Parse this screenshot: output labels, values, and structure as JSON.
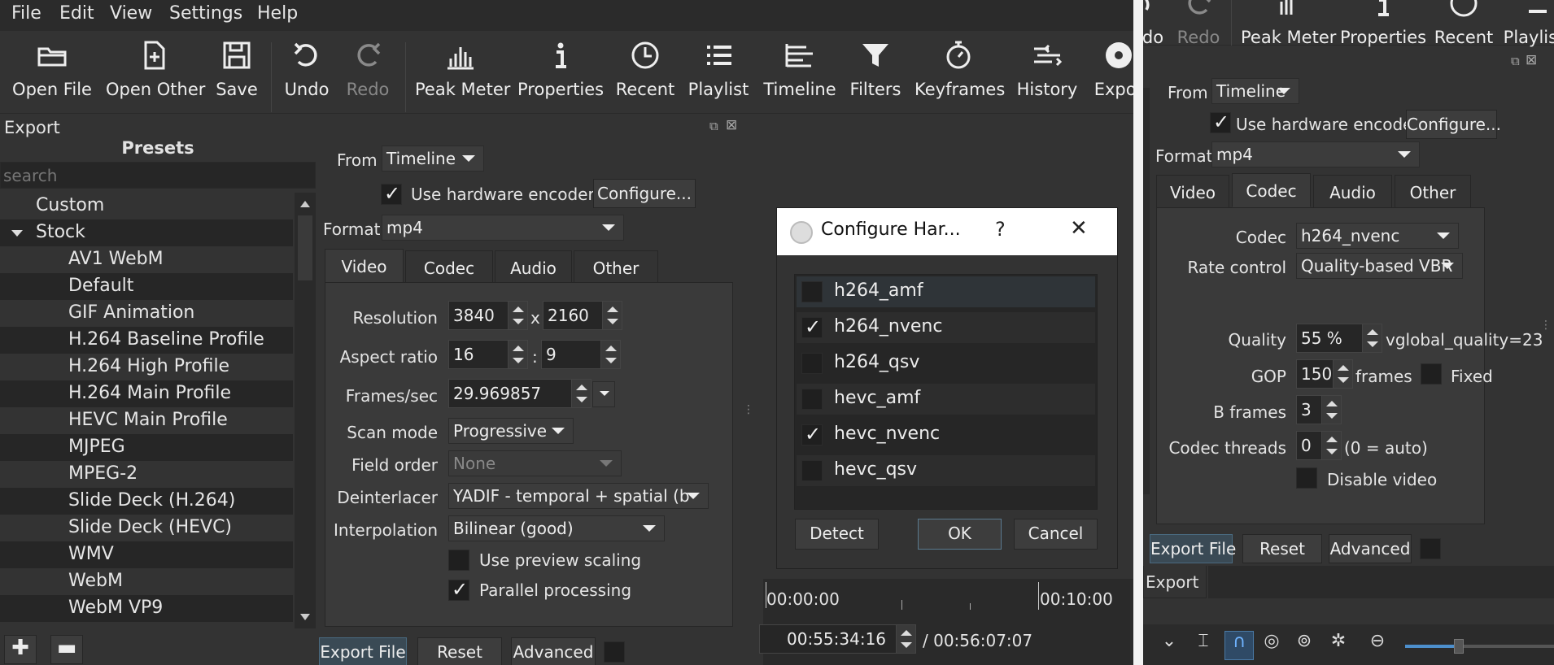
{
  "menu": [
    "File",
    "Edit",
    "View",
    "Settings",
    "Help"
  ],
  "toolbar": {
    "open_file": "Open File",
    "open_other": "Open Other",
    "save": "Save",
    "undo": "Undo",
    "redo": "Redo",
    "peak_meter": "Peak Meter",
    "properties": "Properties",
    "recent": "Recent",
    "playlist": "Playlist",
    "timeline": "Timeline",
    "filters": "Filters",
    "keyframes": "Keyframes",
    "history": "History",
    "export": "Expor"
  },
  "export_panel": {
    "title": "Export",
    "presets_title": "Presets",
    "search_placeholder": "search",
    "presets": [
      "Custom",
      "Stock",
      "AV1 WebM",
      "Default",
      "GIF Animation",
      "H.264 Baseline Profile",
      "H.264 High Profile",
      "H.264 Main Profile",
      "HEVC Main Profile",
      "MJPEG",
      "MPEG-2",
      "Slide Deck (H.264)",
      "Slide Deck (HEVC)",
      "WMV",
      "WebM",
      "WebM VP9"
    ],
    "from_label": "From",
    "from_value": "Timeline",
    "hw_encoder_label": "Use hardware encoder",
    "hw_encoder_checked": true,
    "configure_label": "Configure...",
    "format_label": "Format",
    "format_value": "mp4",
    "tabs": [
      "Video",
      "Codec",
      "Audio",
      "Other"
    ],
    "video": {
      "resolution_label": "Resolution",
      "width": "3840",
      "x_sep": "x",
      "height": "2160",
      "aspect_label": "Aspect ratio",
      "aspect_num": "16",
      "aspect_sep": ":",
      "aspect_den": "9",
      "fps_label": "Frames/sec",
      "fps_value": "29.969857",
      "scan_label": "Scan mode",
      "scan_value": "Progressive",
      "field_label": "Field order",
      "field_value": "None",
      "deint_label": "Deinterlacer",
      "deint_value": "YADIF - temporal + spatial (b",
      "interp_label": "Interpolation",
      "interp_value": "Bilinear (good)",
      "preview_scaling_label": "Use preview scaling",
      "preview_scaling_checked": false,
      "parallel_label": "Parallel processing",
      "parallel_checked": true
    },
    "buttons": {
      "export_file": "Export File",
      "reset": "Reset",
      "advanced": "Advanced"
    }
  },
  "dialog": {
    "title": "Configure Har...",
    "help": "?",
    "close": "✕",
    "encoders": [
      {
        "name": "h264_amf",
        "checked": false
      },
      {
        "name": "h264_nvenc",
        "checked": true
      },
      {
        "name": "h264_qsv",
        "checked": false
      },
      {
        "name": "hevc_amf",
        "checked": false
      },
      {
        "name": "hevc_nvenc",
        "checked": true
      },
      {
        "name": "hevc_qsv",
        "checked": false
      }
    ],
    "detect": "Detect",
    "ok": "OK",
    "cancel": "Cancel"
  },
  "timeline": {
    "ruler_start": "00:00:00",
    "ruler_mid": "00:10:00",
    "current_time": "00:55:34:16",
    "total_time": "/ 00:56:07:07"
  },
  "right": {
    "toolbar": {
      "undo_partial": "do",
      "redo": "Redo",
      "peak_meter": "Peak Meter",
      "properties": "Properties",
      "recent": "Recent",
      "playlist": "Playlist"
    },
    "from_label": "From",
    "from_value": "Timeline",
    "hw_encoder_label": "Use hardware encoder",
    "configure_label": "Configure...",
    "format_label": "Format",
    "format_value": "mp4",
    "tabs": [
      "Video",
      "Codec",
      "Audio",
      "Other"
    ],
    "codec": {
      "codec_label": "Codec",
      "codec_value": "h264_nvenc",
      "rate_label": "Rate control",
      "rate_value": "Quality-based VBR",
      "quality_label": "Quality",
      "quality_value": "55 %",
      "quality_note": "vglobal_quality=23",
      "gop_label": "GOP",
      "gop_value": "150",
      "gop_unit": "frames",
      "fixed_label": "Fixed",
      "bframes_label": "B frames",
      "bframes_value": "3",
      "threads_label": "Codec threads",
      "threads_value": "0",
      "threads_note": "(0 = auto)",
      "disable_video_label": "Disable video"
    },
    "buttons": {
      "export_file": "Export File",
      "reset": "Reset",
      "advanced": "Advanced"
    },
    "bottom_tab": "Export"
  }
}
